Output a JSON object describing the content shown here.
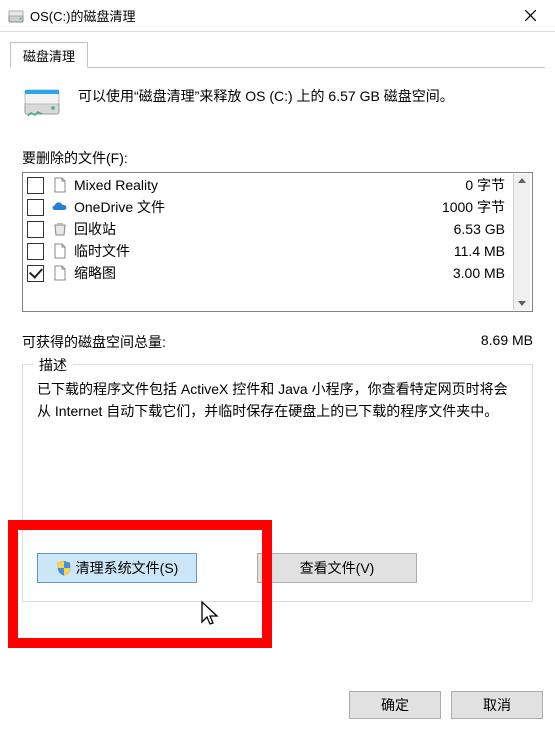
{
  "window": {
    "title": "OS(C:)的磁盘清理",
    "tab_label": "磁盘清理",
    "intro_text": "可以使用“磁盘清理”来释放 OS (C:) 上的 6.57 GB 磁盘空间。",
    "files_to_delete_label": "要删除的文件(F):",
    "files": [
      {
        "name": "Mixed Reality",
        "size": "0 字节",
        "checked": false,
        "icon": "file"
      },
      {
        "name": "OneDrive 文件",
        "size": "1000 字节",
        "checked": false,
        "icon": "onedrive"
      },
      {
        "name": "回收站",
        "size": "6.53 GB",
        "checked": false,
        "icon": "recycle"
      },
      {
        "name": "临时文件",
        "size": "11.4 MB",
        "checked": false,
        "icon": "file"
      },
      {
        "name": "缩略图",
        "size": "3.00 MB",
        "checked": true,
        "icon": "file"
      }
    ],
    "total_label": "可获得的磁盘空间总量:",
    "total_value": "8.69 MB",
    "description_legend": "描述",
    "description_text": "已下载的程序文件包括 ActiveX 控件和 Java 小程序，你查看特定网页时将会从 Internet 自动下载它们，并临时保存在硬盘上的已下载的程序文件夹中。",
    "clean_system_label": "清理系统文件(S)",
    "view_files_label": "查看文件(V)",
    "ok_label": "确定",
    "cancel_label": "取消"
  }
}
